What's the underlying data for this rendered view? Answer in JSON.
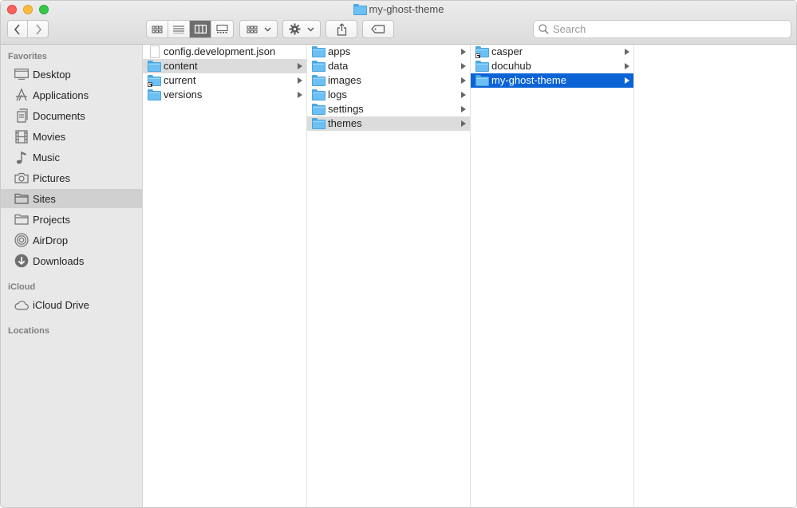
{
  "window": {
    "title": "my-ghost-theme"
  },
  "toolbar": {
    "back_icon": "chevron-left-icon",
    "forward_icon": "chevron-right-icon",
    "view_icons": [
      "icon-view-icon",
      "list-view-icon",
      "column-view-icon",
      "gallery-view-icon"
    ],
    "active_view": "column-view",
    "group_icon": "group-by-icon",
    "action_icon": "gear-icon",
    "share_icon": "share-icon",
    "tag_icon": "tag-icon"
  },
  "search": {
    "placeholder": "Search"
  },
  "sidebar": {
    "sections": [
      {
        "title": "Favorites",
        "items": [
          {
            "label": "Desktop",
            "icon": "desktop-icon"
          },
          {
            "label": "Applications",
            "icon": "applications-icon"
          },
          {
            "label": "Documents",
            "icon": "documents-icon"
          },
          {
            "label": "Movies",
            "icon": "movies-icon"
          },
          {
            "label": "Music",
            "icon": "music-icon"
          },
          {
            "label": "Pictures",
            "icon": "pictures-icon"
          },
          {
            "label": "Sites",
            "icon": "folder-icon",
            "selected": true
          },
          {
            "label": "Projects",
            "icon": "folder-icon"
          },
          {
            "label": "AirDrop",
            "icon": "airdrop-icon"
          },
          {
            "label": "Downloads",
            "icon": "downloads-icon"
          }
        ]
      },
      {
        "title": "iCloud",
        "items": [
          {
            "label": "iCloud Drive",
            "icon": "cloud-icon"
          }
        ]
      },
      {
        "title": "Locations",
        "items": []
      }
    ]
  },
  "columns": [
    {
      "items": [
        {
          "label": "config.development.json",
          "type": "file",
          "arrow": false
        },
        {
          "label": "content",
          "type": "folder",
          "arrow": true,
          "state": "path"
        },
        {
          "label": "current",
          "type": "alias",
          "arrow": true
        },
        {
          "label": "versions",
          "type": "folder",
          "arrow": true
        }
      ]
    },
    {
      "items": [
        {
          "label": "apps",
          "type": "folder",
          "arrow": true
        },
        {
          "label": "data",
          "type": "folder",
          "arrow": true
        },
        {
          "label": "images",
          "type": "folder",
          "arrow": true
        },
        {
          "label": "logs",
          "type": "folder",
          "arrow": true
        },
        {
          "label": "settings",
          "type": "folder",
          "arrow": true
        },
        {
          "label": "themes",
          "type": "folder",
          "arrow": true,
          "state": "path"
        }
      ]
    },
    {
      "items": [
        {
          "label": "casper",
          "type": "alias",
          "arrow": true
        },
        {
          "label": "docuhub",
          "type": "folder",
          "arrow": true
        },
        {
          "label": "my-ghost-theme",
          "type": "folder",
          "arrow": true,
          "state": "selected"
        }
      ]
    },
    {
      "items": []
    }
  ]
}
